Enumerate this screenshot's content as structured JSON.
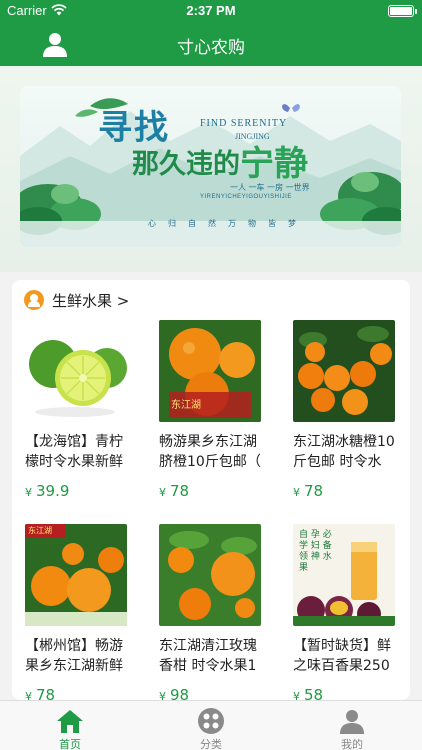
{
  "status_bar": {
    "carrier": "Carrier",
    "time": "2:37 PM"
  },
  "nav": {
    "title": "寸心农购"
  },
  "banner": {
    "headline_1": "寻找",
    "headline_2": "那久违的",
    "headline_3": "宁静",
    "english_1": "FIND SERENITY",
    "english_2": "JINGJING",
    "tagline": "一人 一车 一房 一世界",
    "pinyin": "YIRENYICHEYIGOUYISHIJIE",
    "footer_words": [
      "心",
      "归",
      "自",
      "然",
      "万",
      "物",
      "皆",
      "梦"
    ]
  },
  "section": {
    "title": "生鲜水果 >",
    "products": [
      {
        "name": "【龙海馆】青柠檬时令水果新鲜",
        "price": "39.9",
        "currency": "¥"
      },
      {
        "name": "畅游果乡东江湖脐橙10斤包邮（",
        "price": "78",
        "currency": "¥"
      },
      {
        "name": "东江湖冰糖橙10斤包邮 时令水",
        "price": "78",
        "currency": "¥"
      },
      {
        "name": "【郴州馆】畅游果乡东江湖新鲜",
        "price": "78",
        "currency": "¥"
      },
      {
        "name": "东江湖清江玫瑰香柑 时令水果1",
        "price": "98",
        "currency": "¥"
      },
      {
        "name": "【暂时缺货】鲜之味百香果250",
        "price": "58",
        "currency": "¥"
      }
    ],
    "image_texts": {
      "p2_stamp": "东江湖",
      "p4_stamp": "东江湖",
      "p6_label_1": "自 孕 必",
      "p6_label_2": "学 妇 备",
      "p6_label_3": "领 神 水",
      "p6_label_4": "果"
    }
  },
  "tabbar": {
    "tabs": [
      {
        "label": "首页",
        "active": true
      },
      {
        "label": "分类",
        "active": false
      },
      {
        "label": "我的",
        "active": false
      }
    ]
  },
  "colors": {
    "brand_green": "#1f9a45",
    "accent_orange": "#f29a1f"
  }
}
